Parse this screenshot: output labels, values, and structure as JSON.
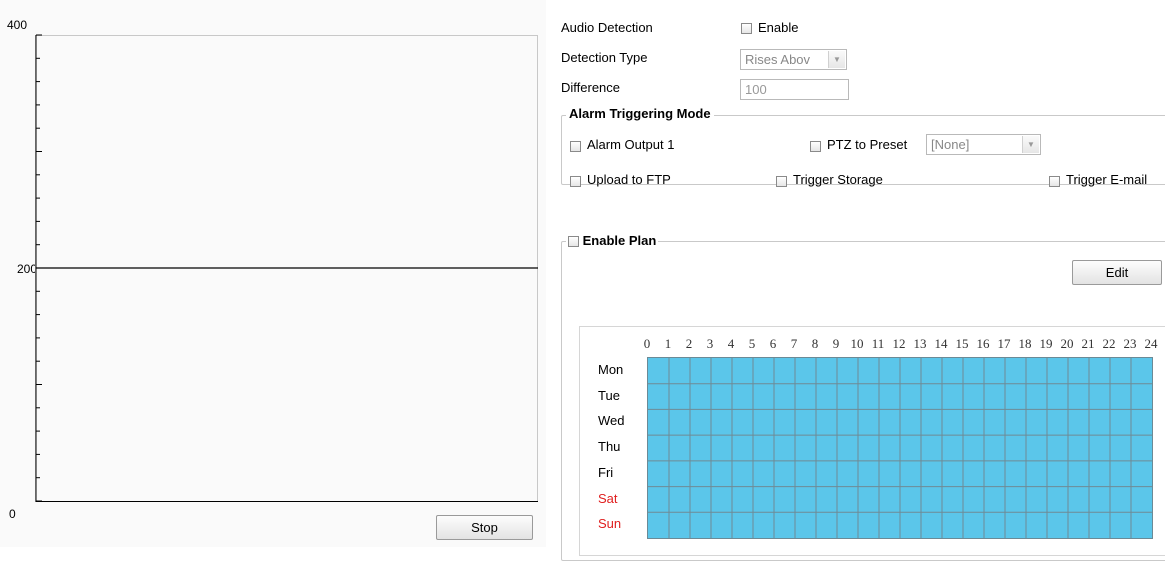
{
  "graph": {
    "y_max_label": "400",
    "y_mid_label": "200",
    "y_min_label": "0",
    "threshold_level": 200,
    "y_max": 400,
    "stop_label": "Stop"
  },
  "settings": {
    "audio_detection_label": "Audio Detection",
    "enable_label": "Enable",
    "detection_type_label": "Detection Type",
    "detection_type_value": "Rises Abov",
    "difference_label": "Difference",
    "difference_value": "100"
  },
  "alarm_mode": {
    "title": "Alarm Triggering Mode",
    "alarm_output_label": "Alarm Output 1",
    "ptz_label": "PTZ to Preset",
    "ptz_value": "[None]",
    "upload_ftp_label": "Upload to FTP",
    "trigger_storage_label": "Trigger Storage",
    "trigger_email_label": "Trigger E-mail"
  },
  "plan": {
    "enable_plan_label": "Enable Plan",
    "edit_label": "Edit",
    "hours": [
      "0",
      "1",
      "2",
      "3",
      "4",
      "5",
      "6",
      "7",
      "8",
      "9",
      "10",
      "11",
      "12",
      "13",
      "14",
      "15",
      "16",
      "17",
      "18",
      "19",
      "20",
      "21",
      "22",
      "23",
      "24"
    ],
    "days": [
      {
        "label": "Mon",
        "color": "#000000"
      },
      {
        "label": "Tue",
        "color": "#000000"
      },
      {
        "label": "Wed",
        "color": "#000000"
      },
      {
        "label": "Thu",
        "color": "#000000"
      },
      {
        "label": "Fri",
        "color": "#000000"
      },
      {
        "label": "Sat",
        "color": "#e02020"
      },
      {
        "label": "Sun",
        "color": "#e02020"
      }
    ],
    "grid_color": "#5bc6ea"
  }
}
